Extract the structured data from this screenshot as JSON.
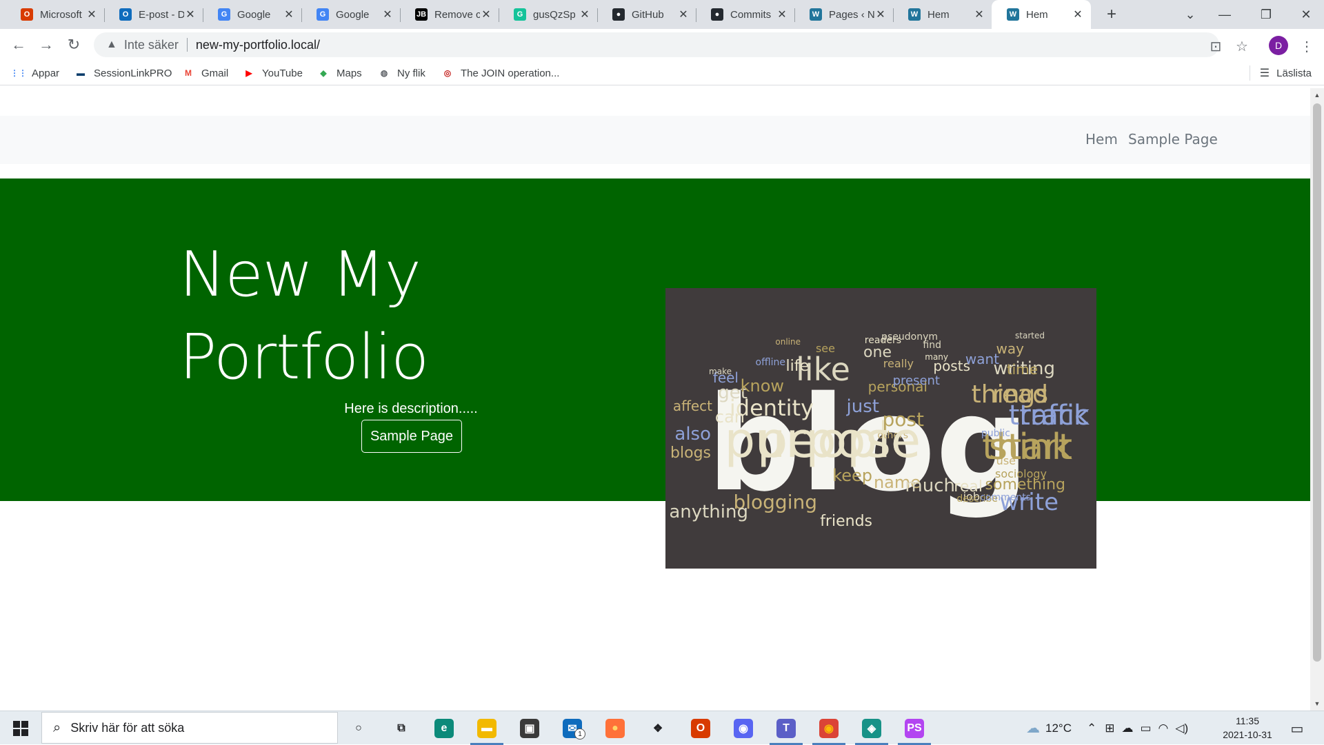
{
  "browser": {
    "tabs": [
      {
        "title": "Microsoft",
        "icon": "office-icon",
        "color": "#d83b01",
        "glyph": "O"
      },
      {
        "title": "E-post - D",
        "icon": "outlook-icon",
        "color": "#0f6cbd",
        "glyph": "O"
      },
      {
        "title": "Google",
        "icon": "google-icon",
        "color": "#4285f4",
        "glyph": "G"
      },
      {
        "title": "Google",
        "icon": "google-icon",
        "color": "#4285f4",
        "glyph": "G"
      },
      {
        "title": "Remove c",
        "icon": "jetbrains-icon",
        "color": "#000000",
        "glyph": "JB"
      },
      {
        "title": "gusQzSp",
        "icon": "grammarly-icon",
        "color": "#15c39a",
        "glyph": "G"
      },
      {
        "title": "GitHub",
        "icon": "github-icon",
        "color": "#24292f",
        "glyph": "●"
      },
      {
        "title": "Commits",
        "icon": "github-icon",
        "color": "#24292f",
        "glyph": "●"
      },
      {
        "title": "Pages ‹ N",
        "icon": "wordpress-icon",
        "color": "#21759b",
        "glyph": "W"
      },
      {
        "title": "Hem",
        "icon": "wordpress-icon",
        "color": "#21759b",
        "glyph": "W"
      },
      {
        "title": "Hem",
        "icon": "wordpress-icon",
        "color": "#21759b",
        "glyph": "W",
        "active": true
      }
    ],
    "new_tab": "+",
    "address": {
      "security_label": "Inte säker",
      "url": "new-my-portfolio.local/"
    },
    "profile_initial": "D",
    "bookmarks": [
      {
        "label": "Appar",
        "icon": "apps-grid-icon",
        "color": "#4285f4"
      },
      {
        "label": "SessionLinkPRO",
        "icon": "sessionlink-icon",
        "color": "#0b3d6b"
      },
      {
        "label": "Gmail",
        "icon": "gmail-icon",
        "color": "#ea4335"
      },
      {
        "label": "YouTube",
        "icon": "youtube-icon",
        "color": "#ff0000"
      },
      {
        "label": "Maps",
        "icon": "maps-icon",
        "color": "#34a853"
      },
      {
        "label": "Ny flik",
        "icon": "globe-icon",
        "color": "#5f6368"
      },
      {
        "label": "The JOIN operation...",
        "icon": "sqlzoo-icon",
        "color": "#c5221f"
      }
    ],
    "reading_list": "Läslista"
  },
  "site": {
    "nav": [
      "Hem",
      "Sample Page"
    ],
    "hero": {
      "title": "New My Portfolio",
      "description": "Here is description.....",
      "button": "Sample Page",
      "background": "#006400"
    },
    "image": {
      "big_word": "blog",
      "words": [
        "people",
        "think",
        "traffic",
        "things",
        "like",
        "identity",
        "post",
        "write",
        "blogging",
        "anything",
        "friends",
        "keep",
        "just",
        "name",
        "much",
        "real",
        "something",
        "also",
        "blogs",
        "get",
        "can",
        "know",
        "feel",
        "affect",
        "writing",
        "posts",
        "time",
        "want",
        "way",
        "one",
        "life",
        "personal",
        "present",
        "really",
        "pseudonym",
        "readers",
        "see",
        "offline",
        "online",
        "make",
        "job",
        "describe",
        "comments",
        "use",
        "find",
        "many",
        "sociology",
        "public",
        "others",
        "started",
        "purpose",
        "start",
        "track",
        "read"
      ]
    }
  },
  "taskbar": {
    "search_placeholder": "Skriv här för att söka",
    "apps": [
      {
        "name": "cortana-icon",
        "glyph": "○",
        "color": "transparent",
        "fg": "#202124"
      },
      {
        "name": "task-view-icon",
        "glyph": "⧉",
        "color": "transparent",
        "fg": "#202124"
      },
      {
        "name": "edge-icon",
        "glyph": "e",
        "color": "#0c8a7a",
        "fg": "#fff"
      },
      {
        "name": "file-explorer-icon",
        "glyph": "▬",
        "color": "#f2b900",
        "fg": "#fff",
        "running": true
      },
      {
        "name": "store-icon",
        "glyph": "▣",
        "color": "#3a3a3a",
        "fg": "#fff"
      },
      {
        "name": "mail-icon",
        "glyph": "✉",
        "color": "#0f6cbd",
        "fg": "#fff",
        "badge": "1"
      },
      {
        "name": "firefox-icon",
        "glyph": "●",
        "color": "#ff7139",
        "fg": "#ffd567"
      },
      {
        "name": "dropbox-icon",
        "glyph": "❖",
        "color": "transparent",
        "fg": "#202124"
      },
      {
        "name": "office-icon",
        "glyph": "O",
        "color": "#d83b01",
        "fg": "#fff"
      },
      {
        "name": "discord-icon",
        "glyph": "◉",
        "color": "#5865f2",
        "fg": "#fff"
      },
      {
        "name": "teams-icon",
        "glyph": "T",
        "color": "#5b5fc7",
        "fg": "#fff",
        "running": true
      },
      {
        "name": "chrome-icon",
        "glyph": "◉",
        "color": "#db4437",
        "fg": "#fbbc04",
        "running": true
      },
      {
        "name": "gitkraken-icon",
        "glyph": "◈",
        "color": "#179287",
        "fg": "#fff",
        "running": true
      },
      {
        "name": "phpstorm-icon",
        "glyph": "PS",
        "color": "#b345f1",
        "fg": "#fff",
        "running": true
      }
    ],
    "weather": "12°C",
    "time": "11:35",
    "date": "2021-10-31"
  }
}
